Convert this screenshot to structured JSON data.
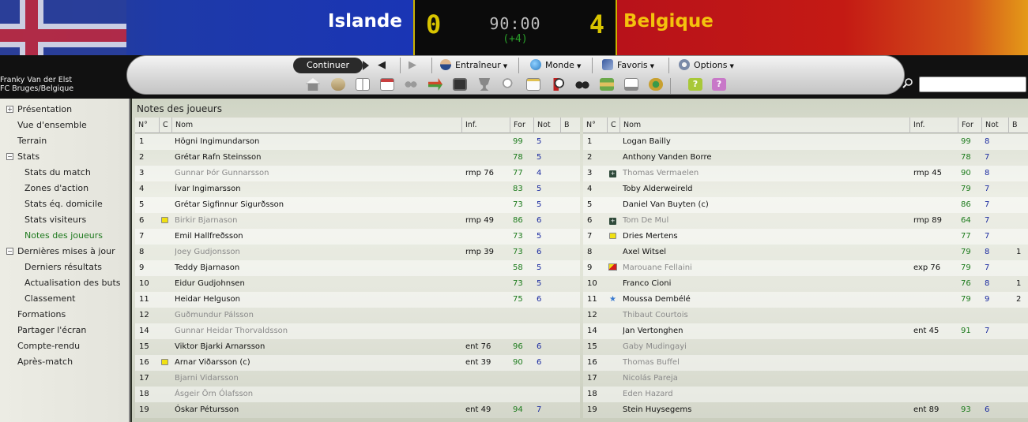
{
  "header": {
    "home_team": "Islande",
    "away_team": "Belgique",
    "home_score": "0",
    "away_score": "4",
    "clock": "90:00",
    "stoppage": "(+4)",
    "colors": {
      "home_bg": "#1e3aa8",
      "away_bg": "#c41a14",
      "away_name": "#f4c20d",
      "score": "#d8c400",
      "stoppage": "#2aa12a"
    }
  },
  "manager": {
    "name": "Franky Van der Elst",
    "club": "FC Bruges/Belgique"
  },
  "toolbar": {
    "continue_label": "Continuer",
    "back_icon": "arrow-left-icon",
    "forward_icon": "arrow-right-icon",
    "menus": [
      {
        "label": "Entraîneur",
        "icon": "manager-icon"
      },
      {
        "label": "Monde",
        "icon": "globe-icon"
      },
      {
        "label": "Favoris",
        "icon": "bookmark-icon"
      },
      {
        "label": "Options",
        "icon": "settings-icon"
      }
    ],
    "tool_icons": [
      "home-icon",
      "inbox-icon",
      "news-icon",
      "calendar-icon",
      "squad-icon",
      "transfer-icon",
      "tactics-icon",
      "trophy-icon",
      "clipboard-icon",
      "scouting-icon",
      "match-icon",
      "binoculars-icon",
      "finances-icon",
      "notes-icon",
      "world-icon",
      "help-icon",
      "help-alt-icon"
    ]
  },
  "search": {
    "placeholder": ""
  },
  "sidebar": {
    "items": [
      {
        "label": "Présentation",
        "level": 0,
        "toggle": "+"
      },
      {
        "label": "Vue d'ensemble",
        "level": 0
      },
      {
        "label": "Terrain",
        "level": 0
      },
      {
        "label": "Stats",
        "level": 0,
        "toggle": "−"
      },
      {
        "label": "Stats du match",
        "level": 1
      },
      {
        "label": "Zones d'action",
        "level": 1
      },
      {
        "label": "Stats éq. domicile",
        "level": 1
      },
      {
        "label": "Stats visiteurs",
        "level": 1
      },
      {
        "label": "Notes des joueurs",
        "level": 1,
        "active": true
      },
      {
        "label": "Dernières mises à jour",
        "level": 0,
        "toggle": "−"
      },
      {
        "label": "Derniers résultats",
        "level": 1
      },
      {
        "label": "Actualisation des buts",
        "level": 1
      },
      {
        "label": "Classement",
        "level": 1
      },
      {
        "label": "Formations",
        "level": 0
      },
      {
        "label": "Partager l'écran",
        "level": 0
      },
      {
        "label": "Compte-rendu",
        "level": 0
      },
      {
        "label": "Après-match",
        "level": 0
      }
    ]
  },
  "main": {
    "title": "Notes des joueurs",
    "columns": [
      "N°",
      "C",
      "Nom",
      "Inf.",
      "For",
      "Not",
      "B"
    ],
    "home_rows": [
      {
        "num": "1",
        "card": "",
        "name": "Högni Ingimundarson",
        "inf": "",
        "for": "99",
        "not": "5",
        "b": "",
        "state": "played"
      },
      {
        "num": "2",
        "card": "",
        "name": "Grétar Rafn Steinsson",
        "inf": "",
        "for": "78",
        "not": "5",
        "b": "",
        "state": "played"
      },
      {
        "num": "3",
        "card": "",
        "name": "Gunnar Þór Gunnarsson",
        "inf": "rmp 76",
        "for": "77",
        "not": "4",
        "b": "",
        "state": "sub"
      },
      {
        "num": "4",
        "card": "",
        "name": "Ívar Ingimarsson",
        "inf": "",
        "for": "83",
        "not": "5",
        "b": "",
        "state": "played"
      },
      {
        "num": "5",
        "card": "",
        "name": "Grétar Sigfinnur Sigurðsson",
        "inf": "",
        "for": "73",
        "not": "5",
        "b": "",
        "state": "played"
      },
      {
        "num": "6",
        "card": "yellow",
        "name": "Birkir Bjarnason",
        "inf": "rmp 49",
        "for": "86",
        "not": "6",
        "b": "",
        "state": "sub"
      },
      {
        "num": "7",
        "card": "",
        "name": "Emil Hallfreðsson",
        "inf": "",
        "for": "73",
        "not": "5",
        "b": "",
        "state": "played"
      },
      {
        "num": "8",
        "card": "",
        "name": "Joey Gudjonsson",
        "inf": "rmp 39",
        "for": "73",
        "not": "6",
        "b": "",
        "state": "sub"
      },
      {
        "num": "9",
        "card": "",
        "name": "Teddy Bjarnason",
        "inf": "",
        "for": "58",
        "not": "5",
        "b": "",
        "state": "played"
      },
      {
        "num": "10",
        "card": "",
        "name": "Eidur Gudjohnsen",
        "inf": "",
        "for": "73",
        "not": "5",
        "b": "",
        "state": "played"
      },
      {
        "num": "11",
        "card": "",
        "name": "Heidar Helguson",
        "inf": "",
        "for": "75",
        "not": "6",
        "b": "",
        "state": "played"
      },
      {
        "num": "12",
        "card": "",
        "name": "Guðmundur Pálsson",
        "inf": "",
        "for": "",
        "not": "",
        "b": "",
        "state": "unused"
      },
      {
        "num": "14",
        "card": "",
        "name": "Gunnar Heidar Thorvaldsson",
        "inf": "",
        "for": "",
        "not": "",
        "b": "",
        "state": "unused"
      },
      {
        "num": "15",
        "card": "",
        "name": "Viktor Bjarki Arnarsson",
        "inf": "ent 76",
        "for": "96",
        "not": "6",
        "b": "",
        "state": "played"
      },
      {
        "num": "16",
        "card": "yellow",
        "name": "Arnar Viðarsson (c)",
        "inf": "ent 39",
        "for": "90",
        "not": "6",
        "b": "",
        "state": "played"
      },
      {
        "num": "17",
        "card": "",
        "name": "Bjarni Vidarsson",
        "inf": "",
        "for": "",
        "not": "",
        "b": "",
        "state": "unused"
      },
      {
        "num": "18",
        "card": "",
        "name": "Ásgeir Örn Ólafsson",
        "inf": "",
        "for": "",
        "not": "",
        "b": "",
        "state": "unused"
      },
      {
        "num": "19",
        "card": "",
        "name": "Óskar Pétursson",
        "inf": "ent 49",
        "for": "94",
        "not": "7",
        "b": "",
        "state": "played"
      }
    ],
    "away_rows": [
      {
        "num": "1",
        "card": "",
        "name": "Logan Bailly",
        "inf": "",
        "for": "99",
        "not": "8",
        "b": "",
        "state": "played"
      },
      {
        "num": "2",
        "card": "",
        "name": "Anthony Vanden Borre",
        "inf": "",
        "for": "78",
        "not": "7",
        "b": "",
        "state": "played"
      },
      {
        "num": "3",
        "card": "sub",
        "name": "Thomas Vermaelen",
        "inf": "rmp 45",
        "for": "90",
        "not": "8",
        "b": "",
        "state": "sub"
      },
      {
        "num": "4",
        "card": "",
        "name": "Toby Alderweireld",
        "inf": "",
        "for": "79",
        "not": "7",
        "b": "",
        "state": "played"
      },
      {
        "num": "5",
        "card": "",
        "name": "Daniel Van Buyten (c)",
        "inf": "",
        "for": "86",
        "not": "7",
        "b": "",
        "state": "played"
      },
      {
        "num": "6",
        "card": "sub",
        "name": "Tom De Mul",
        "inf": "rmp 89",
        "for": "64",
        "not": "7",
        "b": "",
        "state": "sub"
      },
      {
        "num": "7",
        "card": "yellow",
        "name": "Dries Mertens",
        "inf": "",
        "for": "77",
        "not": "7",
        "b": "",
        "state": "played"
      },
      {
        "num": "8",
        "card": "",
        "name": "Axel Witsel",
        "inf": "",
        "for": "79",
        "not": "8",
        "b": "1",
        "state": "played"
      },
      {
        "num": "9",
        "card": "red",
        "name": "Marouane Fellaini",
        "inf": "exp 76",
        "for": "79",
        "not": "7",
        "b": "",
        "state": "sub"
      },
      {
        "num": "10",
        "card": "",
        "name": "Franco Cioni",
        "inf": "",
        "for": "76",
        "not": "8",
        "b": "1",
        "state": "played"
      },
      {
        "num": "11",
        "card": "star",
        "name": "Moussa Dembélé",
        "inf": "",
        "for": "79",
        "not": "9",
        "b": "2",
        "state": "played"
      },
      {
        "num": "12",
        "card": "",
        "name": "Thibaut Courtois",
        "inf": "",
        "for": "",
        "not": "",
        "b": "",
        "state": "unused"
      },
      {
        "num": "14",
        "card": "",
        "name": "Jan Vertonghen",
        "inf": "ent 45",
        "for": "91",
        "not": "7",
        "b": "",
        "state": "played"
      },
      {
        "num": "15",
        "card": "",
        "name": "Gaby Mudingayi",
        "inf": "",
        "for": "",
        "not": "",
        "b": "",
        "state": "unused"
      },
      {
        "num": "16",
        "card": "",
        "name": "Thomas Buffel",
        "inf": "",
        "for": "",
        "not": "",
        "b": "",
        "state": "unused"
      },
      {
        "num": "17",
        "card": "",
        "name": "Nicolás Pareja",
        "inf": "",
        "for": "",
        "not": "",
        "b": "",
        "state": "unused"
      },
      {
        "num": "18",
        "card": "",
        "name": "Eden Hazard",
        "inf": "",
        "for": "",
        "not": "",
        "b": "",
        "state": "unused"
      },
      {
        "num": "19",
        "card": "",
        "name": "Stein Huysegems",
        "inf": "ent 89",
        "for": "93",
        "not": "6",
        "b": "",
        "state": "played"
      }
    ]
  }
}
